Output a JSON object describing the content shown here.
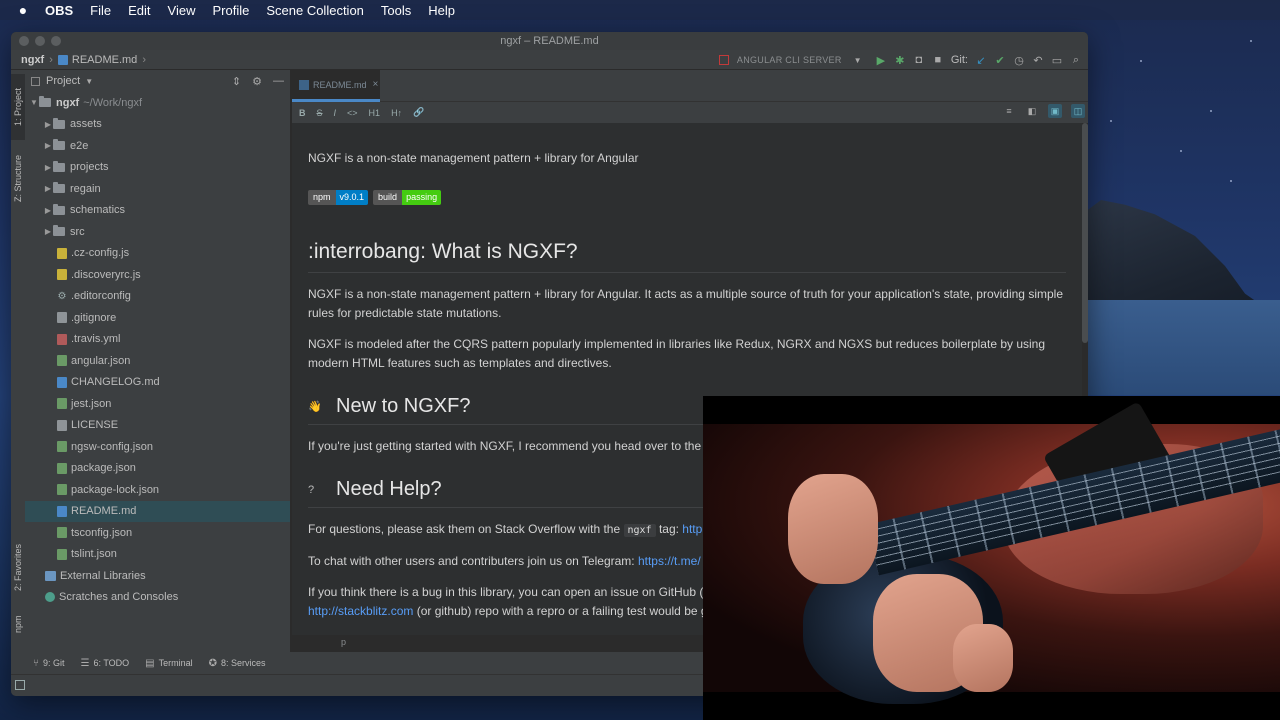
{
  "menubar": {
    "app": "OBS",
    "items": [
      "File",
      "Edit",
      "View",
      "Profile",
      "Scene Collection",
      "Tools",
      "Help"
    ]
  },
  "window": {
    "title": "ngxf – README.md"
  },
  "navbar": {
    "project": "ngxf",
    "file": "README.md",
    "run_config": "ANGULAR CLI SERVER",
    "git_label": "Git:"
  },
  "side_tabs": {
    "project": "1: Project",
    "structure": "Z: Structure",
    "favorites": "2: Favorites",
    "npm": "npm"
  },
  "project_panel": {
    "title": "Project",
    "root": {
      "name": "ngxf",
      "path": "~/Work/ngxf"
    },
    "folders": [
      "assets",
      "e2e",
      "projects",
      "regain",
      "schematics",
      "src"
    ],
    "files": [
      {
        "name": ".cz-config.js",
        "kind": "js"
      },
      {
        "name": ".discoveryrc.js",
        "kind": "js"
      },
      {
        "name": ".editorconfig",
        "kind": "gear"
      },
      {
        "name": ".gitignore",
        "kind": "plain"
      },
      {
        "name": ".travis.yml",
        "kind": "yml"
      },
      {
        "name": "angular.json",
        "kind": "json"
      },
      {
        "name": "CHANGELOG.md",
        "kind": "md"
      },
      {
        "name": "jest.json",
        "kind": "json"
      },
      {
        "name": "LICENSE",
        "kind": "plain"
      },
      {
        "name": "ngsw-config.json",
        "kind": "json"
      },
      {
        "name": "package.json",
        "kind": "json"
      },
      {
        "name": "package-lock.json",
        "kind": "json"
      },
      {
        "name": "README.md",
        "kind": "md",
        "selected": true
      },
      {
        "name": "tsconfig.json",
        "kind": "json"
      },
      {
        "name": "tslint.json",
        "kind": "json"
      }
    ],
    "external_libraries": "External Libraries",
    "scratches": "Scratches and Consoles"
  },
  "editor": {
    "tab_label": "README.md",
    "toolbar_left": [
      "B",
      "S",
      "I",
      "<>",
      "H1",
      "H↑",
      "🔗"
    ],
    "intro": "NGXF is a non-state management pattern + library for Angular",
    "badges": [
      {
        "left": "npm",
        "right": "v9.0.1",
        "color": "#007ec6"
      },
      {
        "left": "build",
        "right": "passing",
        "color": "#4c1"
      }
    ],
    "h1": ":interrobang: What is NGXF?",
    "para1": "NGXF is a non-state management pattern + library for Angular. It acts as a multiple source of truth for your application's state, providing simple rules for predictable state mutations.",
    "para2": "NGXF is modeled after the CQRS pattern popularly implemented in libraries like Redux, NGRX and NGXS but reduces boilerplate by using modern HTML features such as templates and directives.",
    "h2_new": "New to NGXF?",
    "new_text": "If you're just getting started with NGXF, I recommend you head over to the",
    "h2_help": "Need Help?",
    "help_text_prefix": "For questions, please ask them on Stack Overflow with the",
    "help_code": "ngxf",
    "help_text_tag": "tag:",
    "help_link": "http",
    "chat_text": "To chat with other users and contributers join us on Telegram:",
    "chat_link": "https://t.me/",
    "bug_text": "If you think there is a bug in this library, you can open an issue on GitHub (",
    "bug_link": "http://stackblitz.com",
    "bug_text2": "(or github) repo with a repro or a failing test would be g",
    "footer_tag": "p"
  },
  "bottom_tools": [
    {
      "icon": "git-icon",
      "label": "9: Git"
    },
    {
      "icon": "todo-icon",
      "label": "6: TODO"
    },
    {
      "icon": "terminal-icon",
      "label": "Terminal"
    },
    {
      "icon": "services-icon",
      "label": "8: Services"
    }
  ]
}
